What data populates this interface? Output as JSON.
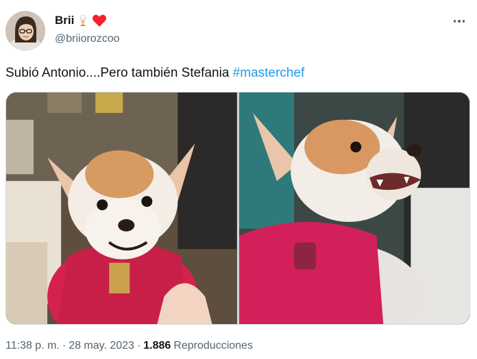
{
  "author": {
    "display_name": "Brii",
    "handle": "@briiorozcoo",
    "emoji_icons": [
      "cooking-icon",
      "heart-icon"
    ],
    "heart_color": "#f91880"
  },
  "tweet": {
    "text": "Subió Antonio....Pero también Stefania ",
    "hashtag": "#masterchef"
  },
  "media": [
    {
      "description_icon": "chihuahua-smiling-photo"
    },
    {
      "description_icon": "chihuahua-snarling-photo"
    }
  ],
  "meta": {
    "time": "11:38 p. m.",
    "separator": "·",
    "date": "28 may. 2023",
    "views_count": "1.886",
    "views_label": "Reproducciones"
  },
  "colors": {
    "accent": "#1d9bf0",
    "secondary_text": "#536471"
  }
}
